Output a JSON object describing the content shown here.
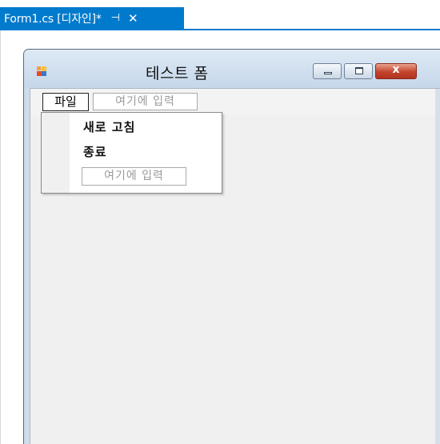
{
  "document_tab": {
    "title": "Form1.cs [디자인]*",
    "pin_glyph": "⊣",
    "close_glyph": "✕",
    "accent_color": "#007acc"
  },
  "form": {
    "title": "테스트 폼",
    "caption_buttons": {
      "minimize_icon": "minimize-icon",
      "maximize_icon": "maximize-icon",
      "close_glyph": "x"
    }
  },
  "menustrip": {
    "file_label": "파일",
    "type_here_placeholder": "여기에 입력"
  },
  "file_menu": {
    "items": [
      {
        "label": "새로 고침"
      },
      {
        "label": "종료"
      }
    ],
    "type_here_placeholder": "여기에 입력"
  }
}
